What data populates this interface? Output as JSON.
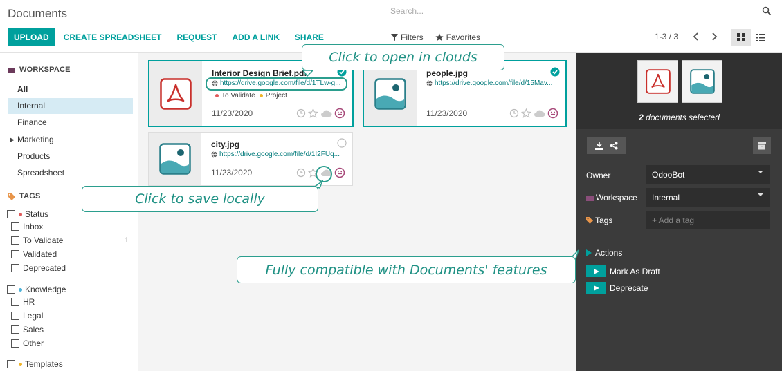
{
  "header": {
    "title": "Documents",
    "search_placeholder": "Search...",
    "buttons": {
      "upload": "UPLOAD",
      "create_spreadsheet": "CREATE SPREADSHEET",
      "request": "REQUEST",
      "add_link": "ADD A LINK",
      "share": "SHARE"
    },
    "filters_label": "Filters",
    "favorites_label": "Favorites",
    "pager": "1-3 / 3"
  },
  "sidebar": {
    "workspace_heading": "WORKSPACE",
    "workspaces": [
      "All",
      "Internal",
      "Finance",
      "Marketing",
      "Products",
      "Spreadsheet"
    ],
    "selected_workspace": "Internal",
    "tags_heading": "TAGS",
    "tag_groups": [
      {
        "name": "Status",
        "color": "#e05a5a",
        "items": [
          {
            "label": "Inbox",
            "count": ""
          },
          {
            "label": "To Validate",
            "count": "1"
          },
          {
            "label": "Validated",
            "count": ""
          },
          {
            "label": "Deprecated",
            "count": ""
          }
        ]
      },
      {
        "name": "Knowledge",
        "color": "#4fb3d9",
        "items": [
          {
            "label": "HR",
            "count": ""
          },
          {
            "label": "Legal",
            "count": ""
          },
          {
            "label": "Sales",
            "count": ""
          },
          {
            "label": "Other",
            "count": ""
          }
        ]
      },
      {
        "name": "Templates",
        "color": "#f0b429",
        "items": []
      }
    ]
  },
  "documents": [
    {
      "name": "Interior Design Brief.pdf",
      "url": "https://drive.google.com/file/d/1TLw-g...",
      "tag1": "To Validate",
      "tag2": "Project",
      "date": "11/23/2020",
      "type": "pdf",
      "selected": true
    },
    {
      "name": "people.jpg",
      "url": "https://drive.google.com/file/d/15Mav...",
      "date": "11/23/2020",
      "type": "image",
      "selected": true
    },
    {
      "name": "city.jpg",
      "url": "https://drive.google.com/file/d/1I2FUq...",
      "date": "11/23/2020",
      "type": "image",
      "selected": false
    }
  ],
  "panel": {
    "selected_count": "2",
    "selected_text": "documents selected",
    "owner_label": "Owner",
    "owner_value": "OdooBot",
    "workspace_label": "Workspace",
    "workspace_value": "Internal",
    "tags_label": "Tags",
    "tags_placeholder": "+ Add a tag",
    "actions_heading": "Actions",
    "actions": [
      "Mark As Draft",
      "Deprecate"
    ]
  },
  "callouts": {
    "open_clouds": "Click to open in clouds",
    "save_locally": "Click to save locally",
    "compatible": "Fully compatible with Documents' features"
  },
  "colors": {
    "accent": "#00a09d",
    "callout": "#2b9e8e",
    "panel_bg": "#3b3b3b",
    "pdf_red": "#d9534f"
  },
  "icons": [
    "search-icon",
    "filter-icon",
    "star-icon",
    "chevron-left-icon",
    "chevron-right-icon",
    "kanban-view-icon",
    "list-view-icon",
    "folder-icon",
    "tag-icon",
    "globe-icon",
    "check-circle-icon",
    "clock-icon",
    "cloud-icon",
    "smiley-icon",
    "download-icon",
    "share-icon",
    "archive-icon",
    "pdf-icon",
    "image-icon",
    "play-icon"
  ]
}
